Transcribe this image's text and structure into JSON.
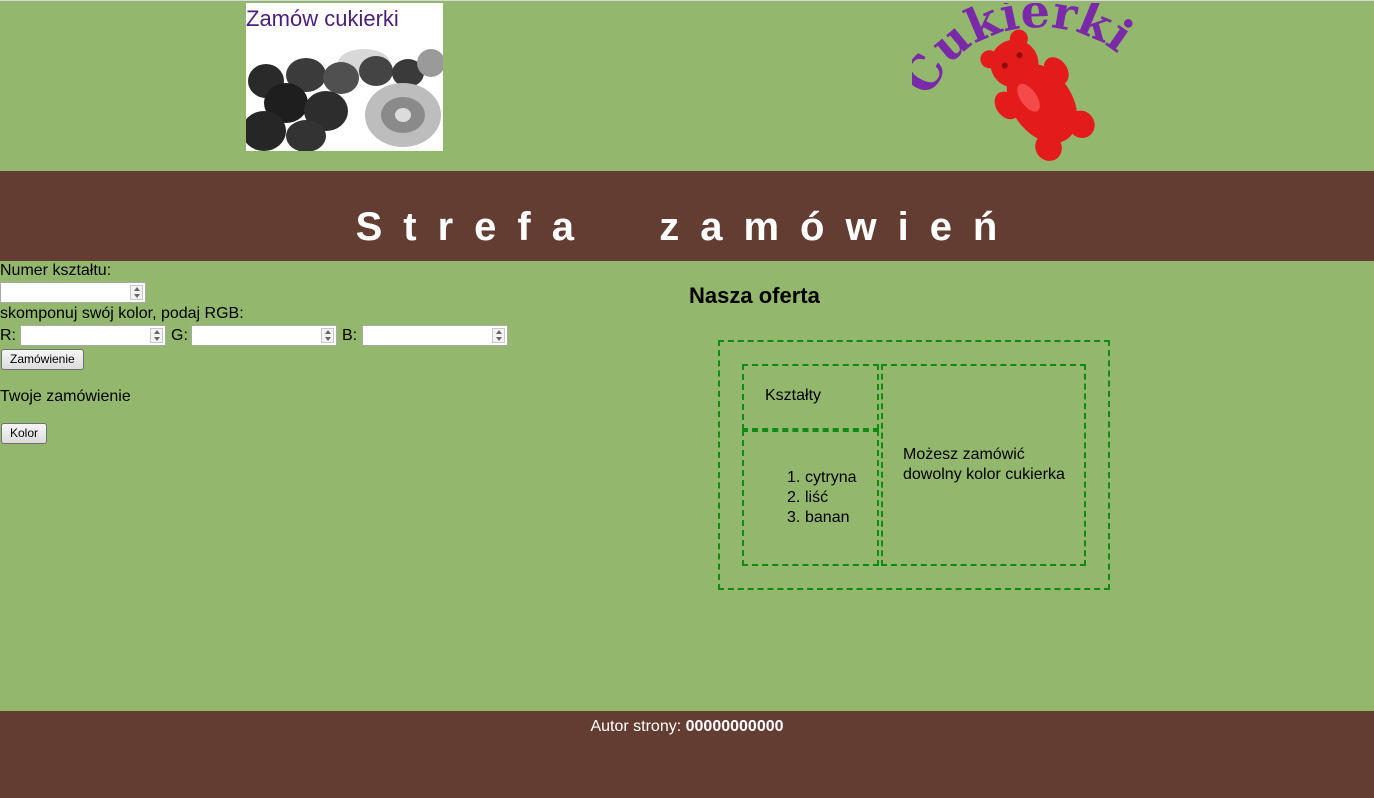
{
  "header": {
    "promo_title": "Zamów cukierki",
    "logo_text": "Cukierki"
  },
  "banner": {
    "title": "Strefa  zamówień"
  },
  "form": {
    "shape_label": "Numer kształtu:",
    "shape_value": "",
    "rgb_label": "skomponuj swój kolor, podaj RGB:",
    "r_label": "R:",
    "g_label": "G:",
    "b_label": "B:",
    "r_value": "",
    "g_value": "",
    "b_value": "",
    "order_button": "Zamówienie",
    "order_text": "Twoje zamówienie",
    "color_button": "Kolor"
  },
  "offer": {
    "title": "Nasza oferta",
    "shapes_heading": "Kształty",
    "shapes": [
      "cytryna",
      "liść",
      "banan"
    ],
    "color_info": "Możesz zamówić dowolny kolor cukierka"
  },
  "footer": {
    "author_label": "Autor strony: ",
    "author_id": "00000000000"
  },
  "colors": {
    "page_bg": "#93b76d",
    "band_bg": "#633d32",
    "dash": "#118a11",
    "logo_text": "#7a2aa8",
    "candy": "#e41b1b"
  }
}
